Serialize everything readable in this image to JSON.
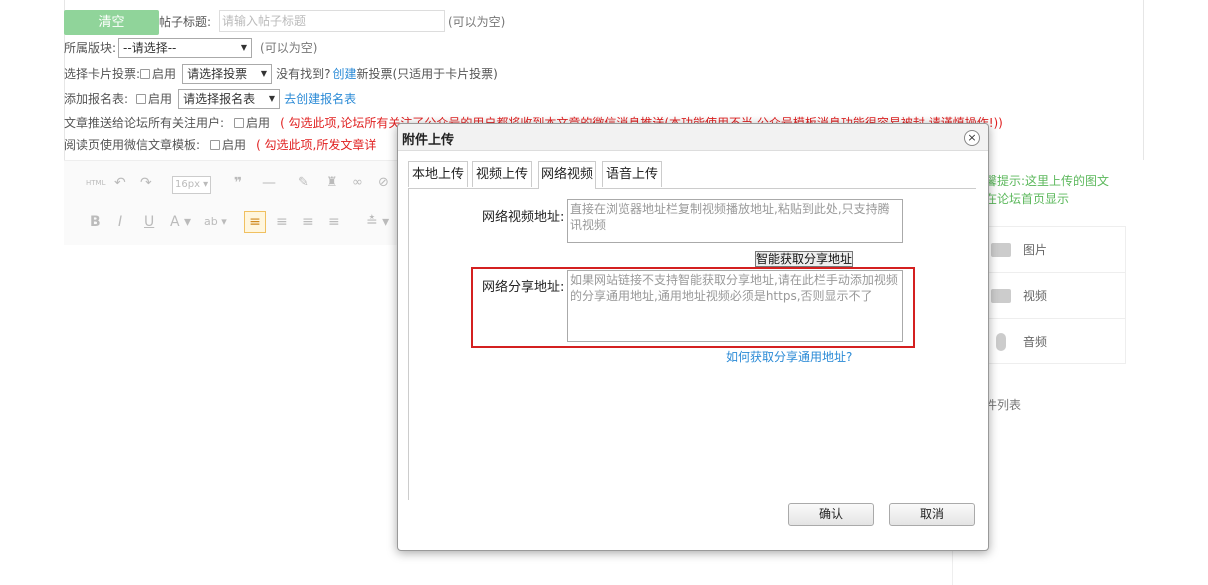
{
  "form": {
    "clear_button": "清空",
    "title_label": "帖子标题:",
    "title_placeholder": "请输入帖子标题",
    "optional_hint": "(可以为空)",
    "section_label": "所属版块:",
    "section_value": "--请选择--",
    "section_hint": "(可以为空)",
    "vote_label": "选择卡片投票:",
    "enable_label": "启用",
    "vote_select": "请选择投票",
    "vote_notfound": "没有找到?",
    "vote_create_link": "创建",
    "vote_suffix": "新投票(只适用于卡片投票)",
    "signup_label": "添加报名表:",
    "signup_select": "请选择报名表",
    "signup_create_link": "去创建报名表",
    "push_label": "文章推送给论坛所有关注用户:",
    "push_warning": "( 勾选此项,论坛所有关注了公众号的用户都将收到本文章的微信消息推送(本功能使用不当,公众号模板消息功能很容易被封,请谨慎操作!))",
    "wechat_label": "阅读页使用微信文章模板:",
    "wechat_warning": "( 勾选此项,所发文章详"
  },
  "editor": {
    "font_size": "16px"
  },
  "right_panel": {
    "tip": "温馨提示:这里上传的图文在论坛首页显示",
    "tip_visible": "馨提示:这里上传的图文",
    "tip_line2": "在论坛首页显示",
    "items": [
      {
        "label": "图片",
        "icon": "image-icon"
      },
      {
        "label": "视频",
        "icon": "video-icon"
      },
      {
        "label": "音频",
        "icon": "microphone-icon"
      }
    ],
    "list_label": "件列表"
  },
  "dialog": {
    "title": "附件上传",
    "close": "×",
    "tabs": [
      "本地上传",
      "视频上传",
      "网络视频",
      "语音上传"
    ],
    "active_tab": 2,
    "video_url_label": "网络视频地址:",
    "video_url_placeholder": "直接在浏览器地址栏复制视频播放地址,粘贴到此处,只支持腾讯视频",
    "smart_button": "智能获取分享地址",
    "share_url_label": "网络分享地址:",
    "share_url_placeholder": "如果网站链接不支持智能获取分享地址,请在此栏手动添加视频的分享通用地址,通用地址视频必须是https,否则显示不了",
    "help_link": "如何获取分享通用地址?",
    "confirm": "确认",
    "cancel": "取消"
  },
  "colors": {
    "clear_button": "#90d49a",
    "link": "#2a8ad6",
    "warning": "#e02020",
    "tip": "#5cb85c",
    "highlight_border": "#d42020"
  }
}
